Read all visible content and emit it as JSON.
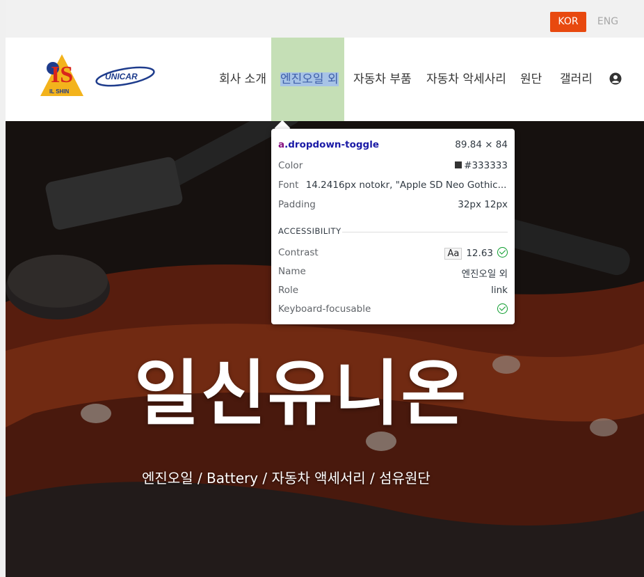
{
  "language": {
    "kor_label": "KOR",
    "eng_label": "ENG",
    "active": "KOR"
  },
  "header": {
    "logo_ilshin_text": "IS",
    "logo_ilshin_caption": "IL SHIN",
    "logo_unicar_text": "UNICAR",
    "nav": [
      {
        "label": "회사 소개"
      },
      {
        "label": "엔진오일 외"
      },
      {
        "label": "자동차 부품"
      },
      {
        "label": "자동차 악세사리"
      },
      {
        "label": "원단"
      },
      {
        "label": "갤러리"
      }
    ],
    "user_icon": "user-circle-icon"
  },
  "hero": {
    "title": "일신유니온",
    "subtitle": "엔진오일 / Battery / 자동차 액세서리 / 섬유원단"
  },
  "inspector": {
    "tag": "a",
    "class": ".dropdown-toggle",
    "dimensions": "89.84 × 84",
    "color_label": "Color",
    "color_value": "#333333",
    "font_label": "Font",
    "font_value": "14.2416px notokr, \"Apple SD Neo Gothic...",
    "padding_label": "Padding",
    "padding_value": "32px 12px",
    "section_title": "ACCESSIBILITY",
    "contrast_label": "Contrast",
    "contrast_aa": "Aa",
    "contrast_value": "12.63",
    "name_label": "Name",
    "name_value": "엔진오일 외",
    "role_label": "Role",
    "role_value": "link",
    "keyboard_label": "Keyboard-focusable"
  },
  "colors": {
    "accent": "#e8490f",
    "nav_text": "#333333",
    "active_bg": "#c5dfb6",
    "selection": "#a7c3e6"
  }
}
